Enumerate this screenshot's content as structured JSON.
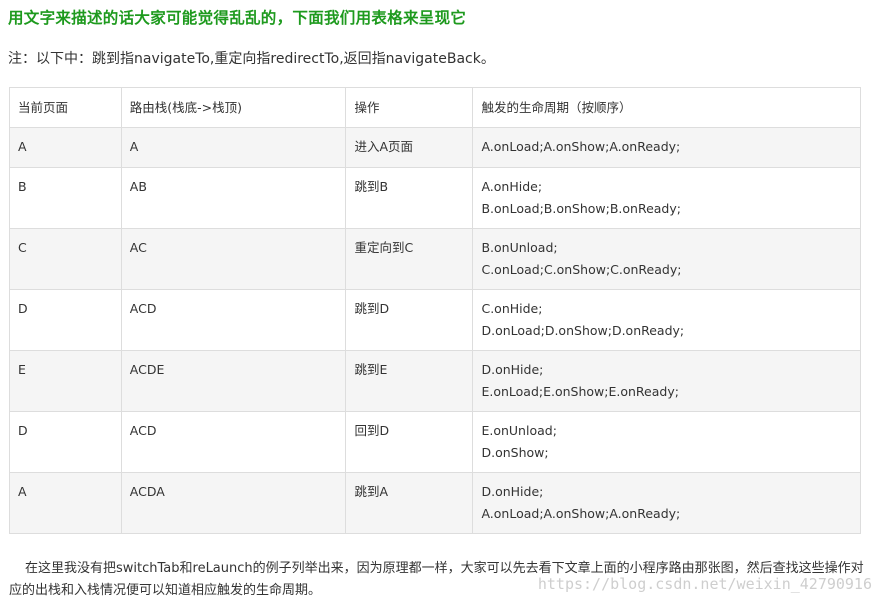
{
  "heading": "用文字来描述的话大家可能觉得乱乱的，下面我们用表格来呈现它",
  "note": "注：以下中：跳到指navigateTo,重定向指redirectTo,返回指navigateBack。",
  "table": {
    "headers": [
      "当前页面",
      "路由栈(栈底->栈顶)",
      "操作",
      "触发的生命周期（按顺序）"
    ],
    "rows": [
      {
        "page": "A",
        "stack": "A",
        "operation": "进入A页面",
        "lifecycle": [
          "A.onLoad;A.onShow;A.onReady;"
        ]
      },
      {
        "page": "B",
        "stack": "AB",
        "operation": "跳到B",
        "lifecycle": [
          "A.onHide;",
          "B.onLoad;B.onShow;B.onReady;"
        ]
      },
      {
        "page": "C",
        "stack": "AC",
        "operation": "重定向到C",
        "lifecycle": [
          "B.onUnload;",
          "C.onLoad;C.onShow;C.onReady;"
        ]
      },
      {
        "page": "D",
        "stack": "ACD",
        "operation": "跳到D",
        "lifecycle": [
          "C.onHide;",
          "D.onLoad;D.onShow;D.onReady;"
        ]
      },
      {
        "page": "E",
        "stack": "ACDE",
        "operation": "跳到E",
        "lifecycle": [
          "D.onHide;",
          "E.onLoad;E.onShow;E.onReady;"
        ]
      },
      {
        "page": "D",
        "stack": "ACD",
        "operation": "回到D",
        "lifecycle": [
          "E.onUnload;",
          "D.onShow;"
        ]
      },
      {
        "page": "A",
        "stack": "ACDA",
        "operation": "跳到A",
        "lifecycle": [
          "D.onHide;",
          "A.onLoad;A.onShow;A.onReady;"
        ]
      }
    ]
  },
  "footer": "在这里我没有把switchTab和reLaunch的例子列举出来，因为原理都一样，大家可以先去看下文章上面的小程序路由那张图，然后查找这些操作对应的出栈和入栈情况便可以知道相应触发的生命周期。",
  "watermark": "https://blog.csdn.net/weixin_42790916",
  "colors": {
    "heading": "#1e9a1e",
    "text": "#333333",
    "border": "#dddddd",
    "stripe": "#f5f5f5"
  }
}
